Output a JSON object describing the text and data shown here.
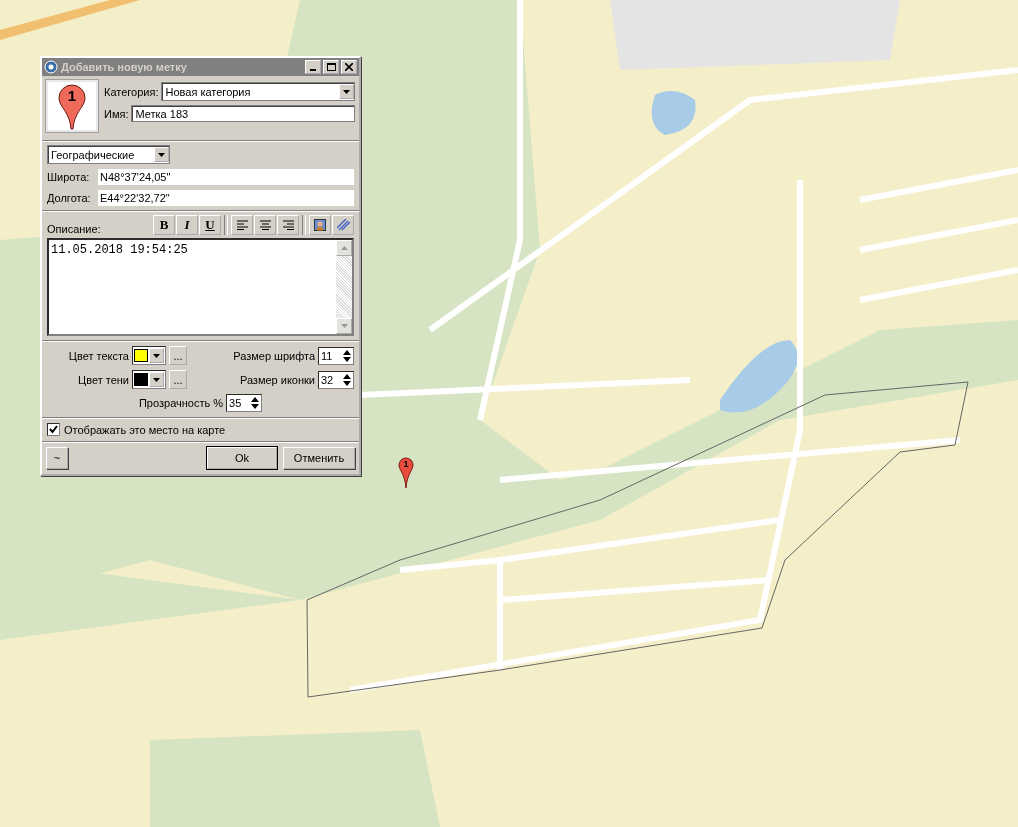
{
  "window": {
    "title": "Добавить новую метку"
  },
  "marker_icon": {
    "number": "1"
  },
  "category": {
    "label": "Категория:",
    "value": "Новая категория"
  },
  "name": {
    "label": "Имя:",
    "value": "Метка 183"
  },
  "coord_format": {
    "value": "Географические"
  },
  "latitude": {
    "label": "Широта:",
    "value": "N48°37'24,05\""
  },
  "longitude": {
    "label": "Долгота:",
    "value": "E44°22'32,72\""
  },
  "description": {
    "label": "Описание:",
    "value": "11.05.2018 19:54:25"
  },
  "format_buttons": [
    "B",
    "I",
    "U"
  ],
  "text_color": {
    "label": "Цвет текста",
    "color": "#ffff00",
    "more": "..."
  },
  "shadow_color": {
    "label": "Цвет тени",
    "color": "#000000",
    "more": "..."
  },
  "font_size": {
    "label": "Размер шрифта",
    "value": "11"
  },
  "icon_size": {
    "label": "Размер иконки",
    "value": "32"
  },
  "opacity": {
    "label": "Прозрачность %",
    "value": "35"
  },
  "show_on_map": {
    "label": "Отображать это место на карте",
    "checked": true
  },
  "buttons": {
    "extra": "~",
    "ok": "Ok",
    "cancel": "Отменить"
  },
  "map_marker": {
    "number": "1"
  }
}
